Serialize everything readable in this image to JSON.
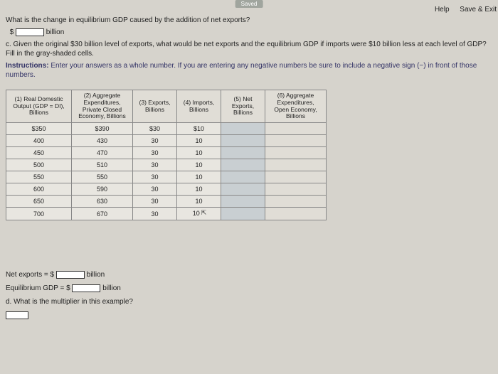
{
  "status": "Saved",
  "top_links": {
    "help": "Help",
    "save_exit": "Save & Exit"
  },
  "q_change": "What is the change in equilibrium GDP caused by the addition of net exports?",
  "line_dollar_billion_prefix": "$",
  "line_dollar_billion_suffix": "billion",
  "part_c": "c. Given the original $30 billion level of exports, what would be net exports and the equilibrium GDP if imports were $10 billion less at each level of GDP? Fill in the gray-shaded cells.",
  "instructions_label": "Instructions:",
  "instructions_text": " Enter your answers as a whole number. If you are entering any negative numbers be sure to include a negative sign (−) in front of those numbers.",
  "headers": {
    "c1": "(1) Real Domestic Output (GDP = DI), Billions",
    "c2": "(2) Aggregate Expenditures, Private Closed Economy, Billions",
    "c3": "(3) Exports, Billions",
    "c4": "(4) Imports, Billions",
    "c5": "(5) Net Exports, Billions",
    "c6": "(6) Aggregate Expenditures, Open Economy, Billions"
  },
  "rows": [
    {
      "c1": "$350",
      "c2": "$390",
      "c3": "$30",
      "c4": "$10"
    },
    {
      "c1": "400",
      "c2": "430",
      "c3": "30",
      "c4": "10"
    },
    {
      "c1": "450",
      "c2": "470",
      "c3": "30",
      "c4": "10"
    },
    {
      "c1": "500",
      "c2": "510",
      "c3": "30",
      "c4": "10"
    },
    {
      "c1": "550",
      "c2": "550",
      "c3": "30",
      "c4": "10"
    },
    {
      "c1": "600",
      "c2": "590",
      "c3": "30",
      "c4": "10"
    },
    {
      "c1": "650",
      "c2": "630",
      "c3": "30",
      "c4": "10"
    },
    {
      "c1": "700",
      "c2": "670",
      "c3": "30",
      "c4": "10"
    }
  ],
  "bottom": {
    "net_exports_label": "Net exports = $",
    "billion1": "billion",
    "eq_gdp_label": "Equilibrium GDP = $",
    "billion2": "billion",
    "part_d": "d. What is the multiplier in this example?"
  }
}
